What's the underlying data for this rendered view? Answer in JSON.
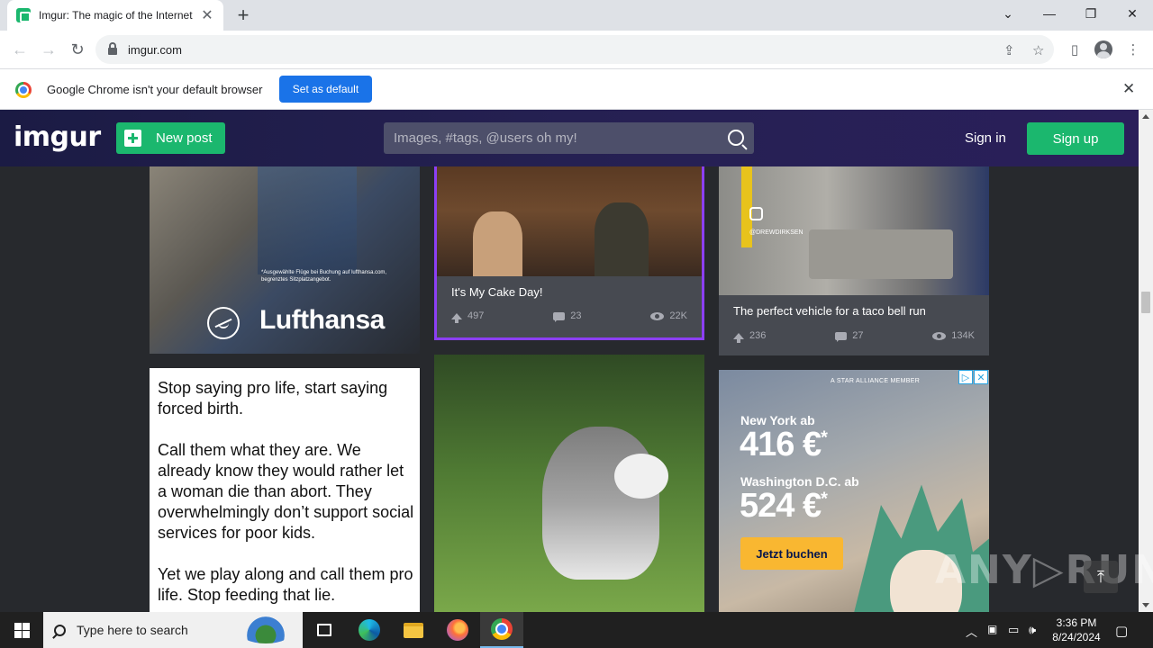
{
  "browser": {
    "tab_title": "Imgur: The magic of the Internet",
    "tab_close": "✕",
    "new_tab": "+",
    "url": "imgur.com",
    "window_controls": {
      "tab_search": "⌄",
      "minimize": "—",
      "restore": "❐",
      "close": "✕"
    },
    "nav": {
      "back": "←",
      "forward": "→",
      "reload": "↻"
    },
    "omnibox_icons": {
      "share": "⇪",
      "bookmark": "☆"
    },
    "toolbar_icons": {
      "side_panel": "▯",
      "menu": "⋮"
    },
    "infobar": {
      "text": "Google Chrome isn't your default browser",
      "button": "Set as default",
      "close": "✕"
    }
  },
  "imgur": {
    "logo": "imgur",
    "new_post": "New post",
    "search_placeholder": "Images, #tags, @users oh my!",
    "sign_in": "Sign in",
    "sign_up": "Sign up",
    "accent_color": "#1bb76e",
    "header_color": "#1b1b44"
  },
  "feed": {
    "lufthansa_ad": {
      "fine_print": "*Ausgewählte Flüge bei Buchung auf lufthansa.com, begrenztes Sitzplatzangebot.",
      "brand": "Lufthansa"
    },
    "cake_post": {
      "title": "It's My Cake Day!",
      "upvotes": "497",
      "comments": "23",
      "views": "22K"
    },
    "taco_post": {
      "title": "The perfect vehicle for a taco bell run",
      "upvotes": "236",
      "comments": "27",
      "views": "134K",
      "instagram_handle": "@DREWDIRKSEN"
    },
    "text_post": {
      "paragraphs": [
        "Stop saying pro life, start saying forced birth.",
        "Call them what they are. We already know they would rather let a woman die than abort. They overwhelmingly don’t support social services for poor kids.",
        "Yet we play along and call them pro life. Stop feeding that lie."
      ]
    },
    "flight_ad": {
      "alliance": "A STAR ALLIANCE MEMBER",
      "route1": "New York ab",
      "price1": "416 €",
      "route2": "Washington D.C. ab",
      "price2": "524 €",
      "asterisk": "*",
      "cta": "Jetzt buchen",
      "ad_choices": "▷",
      "ad_close": "✕"
    }
  },
  "watermark": "ANY▷RUN",
  "scroll_top": "⤒",
  "taskbar": {
    "search_placeholder": "Type here to search",
    "time": "3:36 PM",
    "date": "8/24/2024",
    "tray_icons": {
      "chevron": "︿",
      "network": "▭",
      "volume": "🕪",
      "notification": "▢"
    }
  }
}
